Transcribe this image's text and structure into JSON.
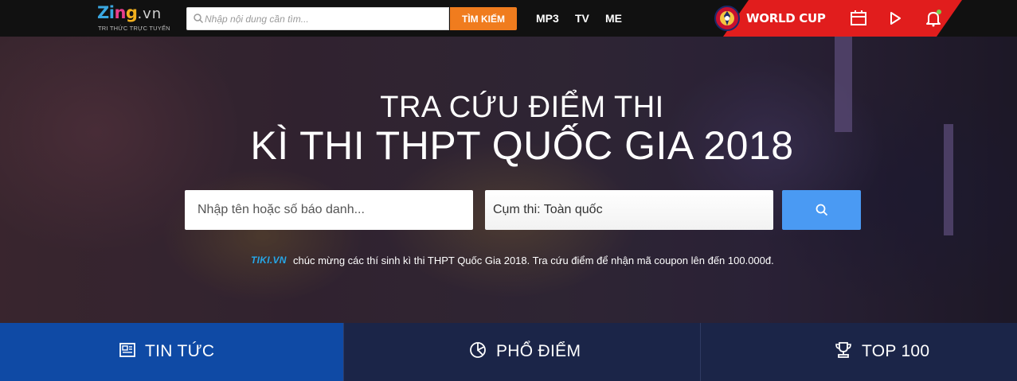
{
  "header": {
    "logo": {
      "zi": "Zi",
      "n": "n",
      "g": "g",
      "domain": ".vn",
      "tagline": "TRI THỨC TRỰC TUYẾN"
    },
    "search": {
      "placeholder": "Nhập nội dung cần tìm...",
      "button_label": "TÌM KIẾM"
    },
    "nav": [
      {
        "label": "MP3"
      },
      {
        "label": "TV"
      },
      {
        "label": "ME"
      }
    ],
    "world_cup_label": "WORLD CUP",
    "icons": [
      "calendar-icon",
      "play-icon",
      "bell-icon"
    ]
  },
  "hero": {
    "title_line_1": "TRA CỨU ĐIỂM THI",
    "title_line_2": "KÌ THI THPT QUỐC GIA 2018",
    "name_input_placeholder": "Nhập tên hoặc số báo danh...",
    "cluster_select_value": "Cụm thi: Toàn quốc",
    "search_icon": "search-icon",
    "promo": {
      "brand": "TIKI.VN",
      "text": "chúc mừng các thí sinh kì thi THPT Quốc Gia 2018. Tra cứu điểm để nhận mã coupon lên đến 100.000đ."
    }
  },
  "tabs": [
    {
      "label": "TIN TỨC",
      "icon": "news-icon",
      "active": true
    },
    {
      "label": "PHỔ ĐIỂM",
      "icon": "pie-chart-icon",
      "active": false
    },
    {
      "label": "TOP 100",
      "icon": "trophy-icon",
      "active": false
    }
  ],
  "colors": {
    "topbar": "#111111",
    "search_button": "#f07c1e",
    "world_cup_band": "#e11d1d",
    "primary_button": "#4a9af3",
    "tab_active": "#0f4aa5",
    "tab_bar": "#1b2548",
    "tiki_brand": "#26a7e8"
  }
}
